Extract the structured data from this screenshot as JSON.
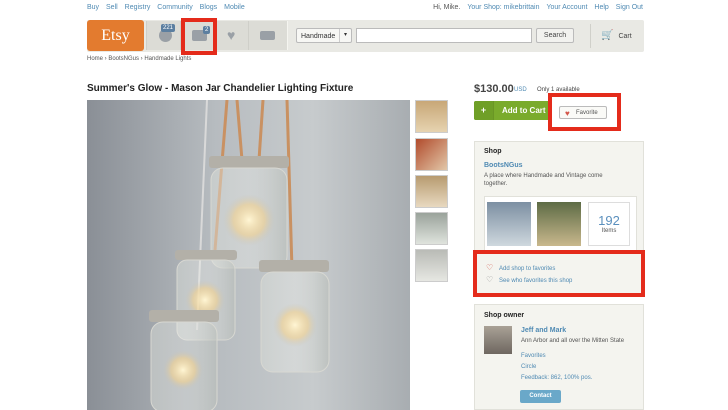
{
  "top_nav": {
    "links": [
      "Buy",
      "Sell",
      "Registry",
      "Community",
      "Blogs",
      "Mobile"
    ],
    "greeting": "Hi, Mike.",
    "user_links": [
      "Your Shop: mikebrittain",
      "Your Account",
      "Help",
      "Sign Out"
    ]
  },
  "header": {
    "logo": "Etsy",
    "activity_count": "221",
    "messages_count": "2",
    "category_select": "Handmade",
    "search_button": "Search",
    "cart_label": "Cart"
  },
  "breadcrumb": "Home › BootsNGus › Handmade Lights",
  "listing": {
    "title": "Summer's Glow - Mason Jar Chandelier Lighting Fixture",
    "price": "$130.00",
    "currency": "USD",
    "availability": "Only 1 available",
    "add_to_cart": "Add to Cart",
    "favorite": "Favorite"
  },
  "shop": {
    "heading": "Shop",
    "name": "BootsNGus",
    "description": "A place where Handmade and Vintage come together.",
    "item_count": "192",
    "item_label": "Items",
    "add_favorites": "Add shop to favorites",
    "see_who": "See who favorites this shop"
  },
  "owner": {
    "heading": "Shop owner",
    "name": "Jeff and Mark",
    "location": "Ann Arbor and all over the Mitten State",
    "links": [
      "Favorites",
      "Circle"
    ],
    "feedback": "Feedback: 862, 100% pos.",
    "contact": "Contact"
  },
  "colors": {
    "highlight_box": "#e42b1b",
    "etsy_orange": "#e37b2f",
    "cart_green": "#7aab2c",
    "link_blue": "#4f8ab3"
  }
}
